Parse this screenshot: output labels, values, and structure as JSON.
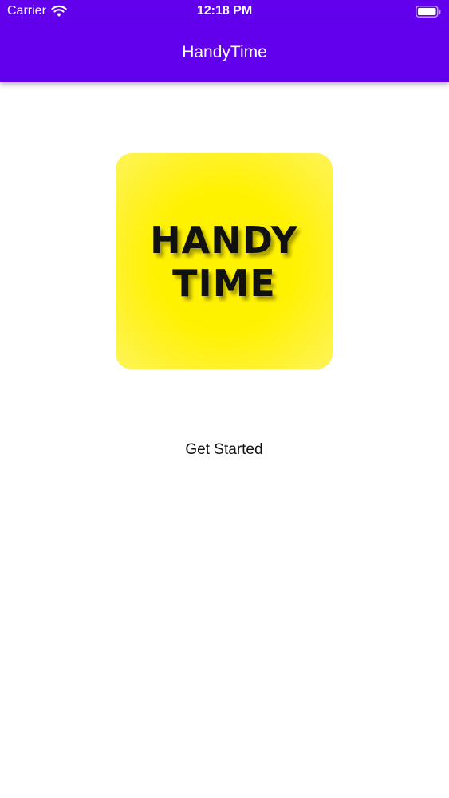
{
  "status_bar": {
    "carrier": "Carrier",
    "time": "12:18 PM",
    "icons": [
      "wifi-icon",
      "battery-icon"
    ]
  },
  "app_bar": {
    "title": "HandyTime",
    "color": "#6200ee"
  },
  "logo": {
    "line1": "HANDY",
    "line2": "TIME",
    "color": "#fff200"
  },
  "main": {
    "get_started_label": "Get Started"
  }
}
